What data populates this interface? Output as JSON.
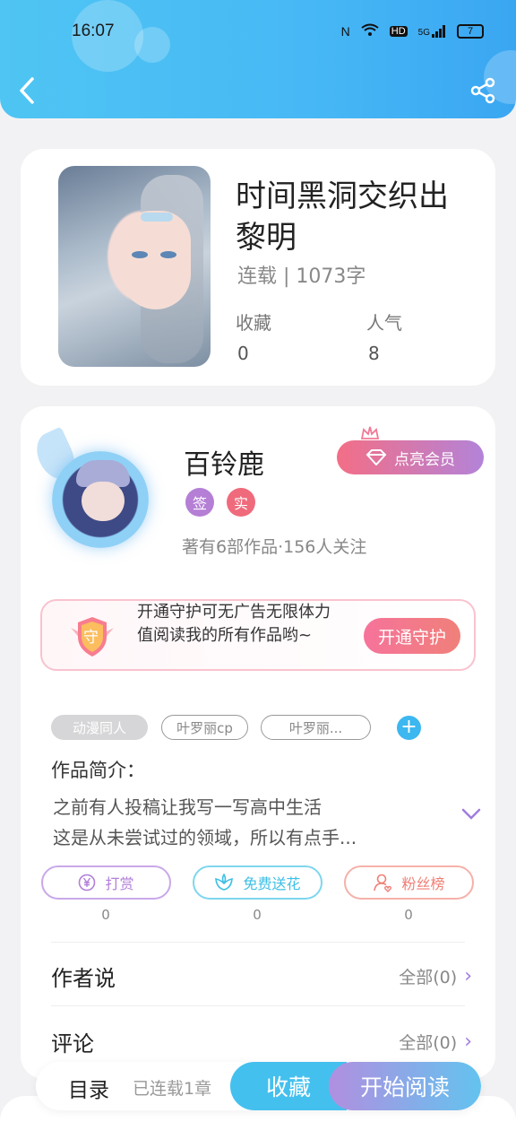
{
  "status_bar": {
    "time": "16:07",
    "network": "5G",
    "battery": "7"
  },
  "book": {
    "title": "时间黑洞交织出黎明",
    "status": "连载 | 1073字",
    "stats": [
      {
        "label": "收藏",
        "value": "0"
      },
      {
        "label": "人气",
        "value": "8"
      }
    ]
  },
  "author": {
    "name": "百铃鹿",
    "vip_label": "点亮会员",
    "badges": [
      {
        "text": "签",
        "color": "#b57fd6"
      },
      {
        "text": "实",
        "color": "#ef6b7c"
      }
    ],
    "meta": "著有6部作品·156人关注"
  },
  "guard": {
    "icon_text": "守",
    "text": "开通守护可无广告无限体力值阅读我的所有作品哟~",
    "button": "开通守护"
  },
  "tags": [
    "动漫同人",
    "叶罗丽cp",
    "叶罗丽..."
  ],
  "intro": {
    "title": "作品简介：",
    "text": "之前有人投稿让我写一写高中生活\n这是从未尝试过的领域，所以有点手..."
  },
  "actions": [
    {
      "label": "打赏",
      "count": "0",
      "icon": "yen-coin-icon",
      "color": "#b17fd8"
    },
    {
      "label": "免费送花",
      "count": "0",
      "icon": "flower-icon",
      "color": "#3dbfe6"
    },
    {
      "label": "粉丝榜",
      "count": "0",
      "icon": "fan-user-icon",
      "color": "#ef7f76"
    }
  ],
  "author_says": {
    "title": "作者说",
    "link": "全部(0)"
  },
  "comments": {
    "title": "评论",
    "link": "全部(0)"
  },
  "bottom": {
    "toc": "目录",
    "toc_status": "已连载1章",
    "collect": "收藏",
    "read": "开始阅读"
  }
}
